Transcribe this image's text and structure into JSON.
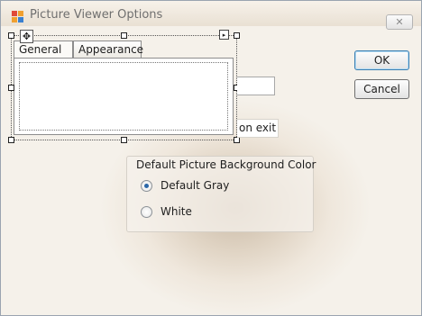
{
  "window": {
    "title": "Picture Viewer Options",
    "close_symbol": "✕",
    "app_icon": "form-icon"
  },
  "tabs": [
    {
      "label": "General",
      "selected": true
    },
    {
      "label": "Appearance",
      "selected": false
    }
  ],
  "designer": {
    "move_glyph": "✥",
    "smart_tag_symbol": "▸"
  },
  "partial_checkbox_text": "on exit",
  "buttons": {
    "ok": "OK",
    "cancel": "Cancel"
  },
  "background_group": {
    "title": "Default Picture Background Color",
    "options": [
      {
        "label": "Default Gray",
        "checked": true
      },
      {
        "label": "White",
        "checked": false
      }
    ]
  },
  "colors": {
    "accent": "#3c7fb1",
    "radio_dot": "#2b67a8"
  }
}
